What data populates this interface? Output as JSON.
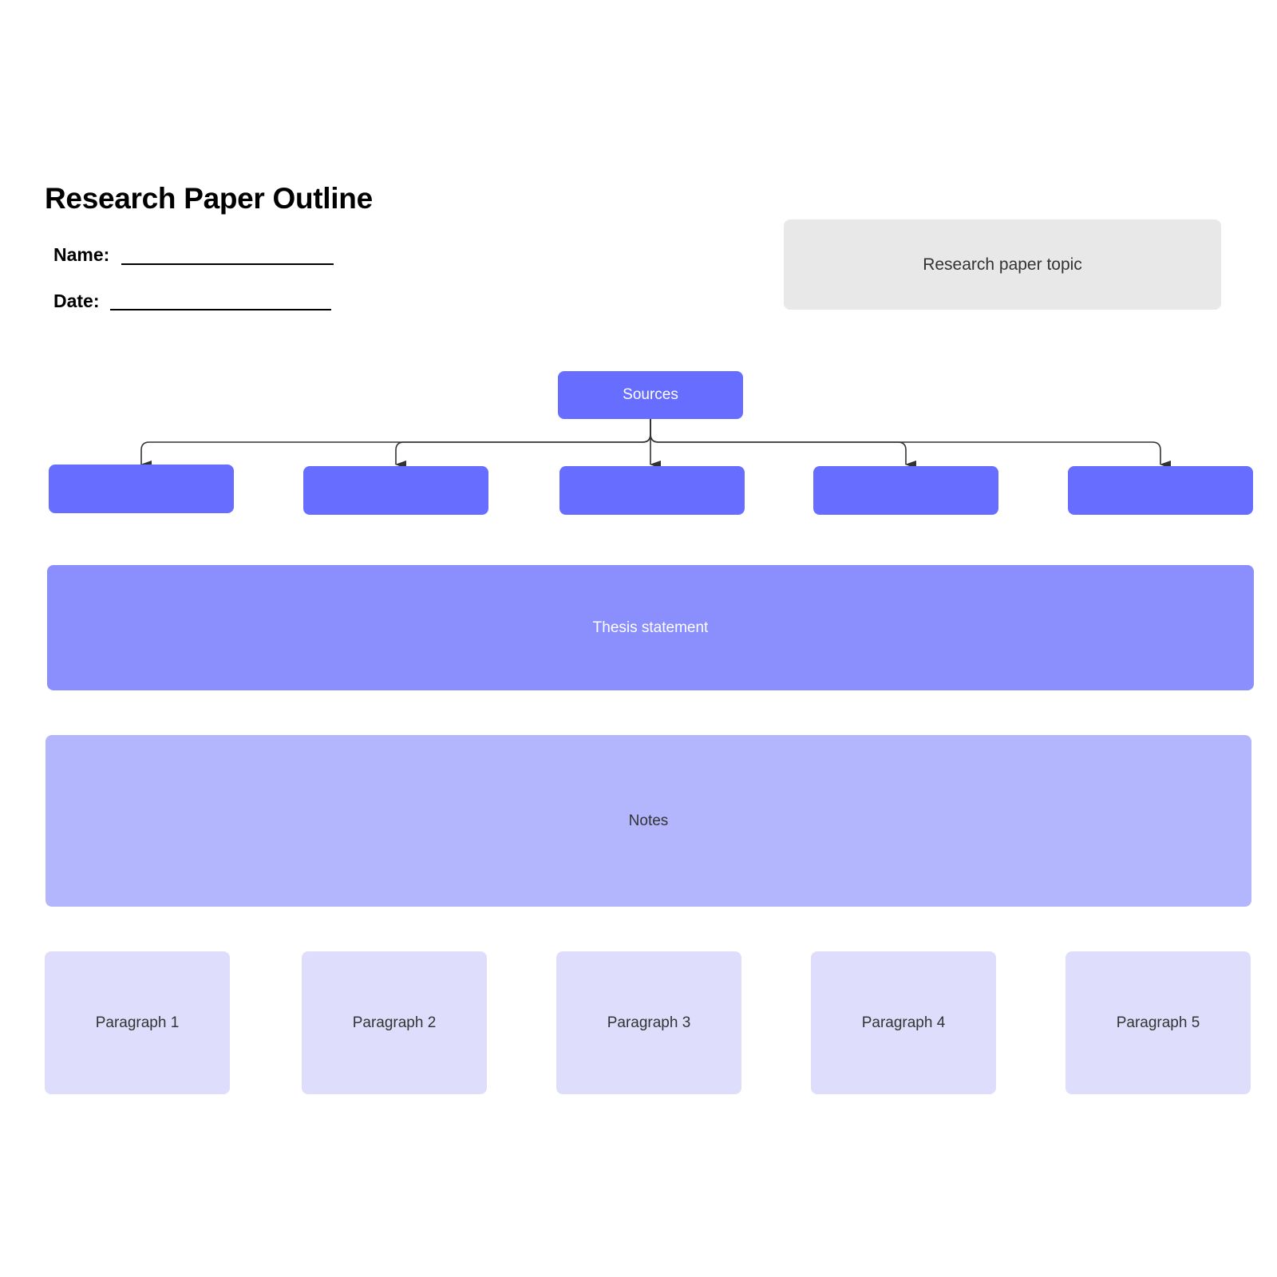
{
  "header": {
    "title": "Research Paper Outline",
    "name_label": "Name:",
    "date_label": "Date:"
  },
  "topic": {
    "label": "Research paper topic"
  },
  "sources": {
    "label": "Sources",
    "children": [
      "",
      "",
      "",
      "",
      ""
    ]
  },
  "thesis": {
    "label": "Thesis statement"
  },
  "notes": {
    "label": "Notes"
  },
  "paragraphs": [
    "Paragraph 1",
    "Paragraph 2",
    "Paragraph 3",
    "Paragraph 4",
    "Paragraph 5"
  ],
  "colors": {
    "sources": "#666dff",
    "thesis": "#8a8ffd",
    "notes": "#b3b6fd",
    "paragraph": "#dedefc",
    "topic": "#e8e8e8",
    "connector": "#333333"
  }
}
